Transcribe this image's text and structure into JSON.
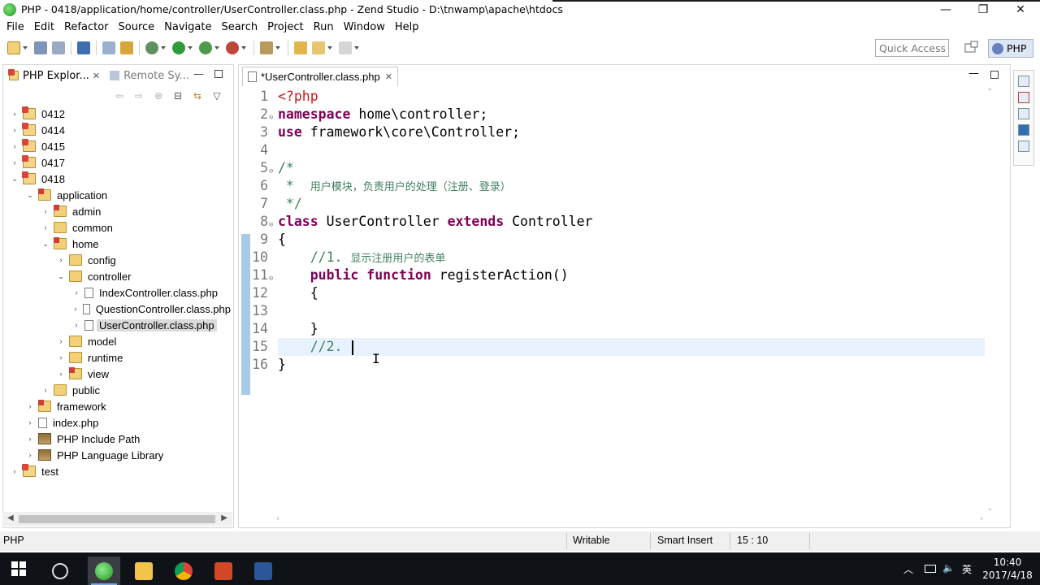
{
  "window": {
    "title": "PHP - 0418/application/home/controller/UserController.class.php - Zend Studio - D:\\tnwamp\\apache\\htdocs",
    "minimize_glyph": "—",
    "restore_glyph": "❐",
    "close_glyph": "✕"
  },
  "menu": [
    "File",
    "Edit",
    "Refactor",
    "Source",
    "Navigate",
    "Search",
    "Project",
    "Run",
    "Window",
    "Help"
  ],
  "toolbar": {
    "quick_access": "Quick Access",
    "perspective_label": "PHP"
  },
  "left_panel": {
    "tabs": [
      {
        "label": "PHP Explor...",
        "close": "✕"
      },
      {
        "label": "Remote Sy...",
        "close": ""
      }
    ],
    "min_glyph": "—",
    "toolbar_glyphs": [
      "⇦",
      "⇨",
      "⊛",
      "⊟",
      "⇆",
      "▽"
    ],
    "tree": [
      {
        "label": "0412",
        "depth": 0,
        "twisty": "›",
        "icon": "project"
      },
      {
        "label": "0414",
        "depth": 0,
        "twisty": "›",
        "icon": "project"
      },
      {
        "label": "0415",
        "depth": 0,
        "twisty": "›",
        "icon": "project"
      },
      {
        "label": "0417",
        "depth": 0,
        "twisty": "›",
        "icon": "project"
      },
      {
        "label": "0418",
        "depth": 0,
        "twisty": "⌄",
        "icon": "project"
      },
      {
        "label": "application",
        "depth": 1,
        "twisty": "⌄",
        "icon": "folder-lib"
      },
      {
        "label": "admin",
        "depth": 2,
        "twisty": "›",
        "icon": "folder-lib"
      },
      {
        "label": "common",
        "depth": 2,
        "twisty": "›",
        "icon": "folder"
      },
      {
        "label": "home",
        "depth": 2,
        "twisty": "⌄",
        "icon": "folder-lib"
      },
      {
        "label": "config",
        "depth": 3,
        "twisty": "›",
        "icon": "folder"
      },
      {
        "label": "controller",
        "depth": 3,
        "twisty": "⌄",
        "icon": "folder"
      },
      {
        "label": "IndexController.class.php",
        "depth": 4,
        "twisty": "›",
        "icon": "file"
      },
      {
        "label": "QuestionController.class.php",
        "depth": 4,
        "twisty": "›",
        "icon": "file"
      },
      {
        "label": "UserController.class.php",
        "depth": 4,
        "twisty": "›",
        "icon": "file",
        "selected": true
      },
      {
        "label": "model",
        "depth": 3,
        "twisty": "›",
        "icon": "folder"
      },
      {
        "label": "runtime",
        "depth": 3,
        "twisty": "›",
        "icon": "folder"
      },
      {
        "label": "view",
        "depth": 3,
        "twisty": "›",
        "icon": "folder-lib"
      },
      {
        "label": "public",
        "depth": 2,
        "twisty": "›",
        "icon": "folder"
      },
      {
        "label": "framework",
        "depth": 1,
        "twisty": "›",
        "icon": "folder-lib"
      },
      {
        "label": "index.php",
        "depth": 1,
        "twisty": "›",
        "icon": "file"
      },
      {
        "label": "PHP Include Path",
        "depth": 1,
        "twisty": "›",
        "icon": "lib"
      },
      {
        "label": "PHP Language Library",
        "depth": 1,
        "twisty": "›",
        "icon": "lib"
      },
      {
        "label": "test",
        "depth": 0,
        "twisty": "›",
        "icon": "project"
      }
    ]
  },
  "editor": {
    "tab_label": "*UserController.class.php",
    "tab_close": "✕",
    "min_glyph": "—",
    "current_line": 15,
    "lines": [
      {
        "n": "1",
        "fold": "",
        "tokens": [
          {
            "t": "<?php",
            "c": "tag"
          }
        ]
      },
      {
        "n": "2",
        "fold": "⊖",
        "tokens": [
          {
            "t": "namespace",
            "c": "kw"
          },
          {
            "t": " home\\controller;",
            "c": "plain"
          }
        ]
      },
      {
        "n": "3",
        "fold": "",
        "tokens": [
          {
            "t": "use",
            "c": "kw"
          },
          {
            "t": " framework\\core\\Controller;",
            "c": "plain"
          }
        ]
      },
      {
        "n": "4",
        "fold": "",
        "tokens": []
      },
      {
        "n": "5",
        "fold": "⊖",
        "tokens": [
          {
            "t": "/*",
            "c": "cm"
          }
        ]
      },
      {
        "n": "6",
        "fold": "",
        "tokens": [
          {
            "t": " *  ",
            "c": "cm"
          },
          {
            "t": "用户模块，负责用户的处理（注册、登录）",
            "c": "cm-cjk"
          }
        ]
      },
      {
        "n": "7",
        "fold": "",
        "tokens": [
          {
            "t": " */",
            "c": "cm"
          }
        ]
      },
      {
        "n": "8",
        "fold": "⊖",
        "tokens": [
          {
            "t": "class",
            "c": "kw"
          },
          {
            "t": " UserController ",
            "c": "plain"
          },
          {
            "t": "extends",
            "c": "kw"
          },
          {
            "t": " Controller",
            "c": "plain"
          }
        ]
      },
      {
        "n": "9",
        "fold": "",
        "tokens": [
          {
            "t": "{",
            "c": "plain"
          }
        ]
      },
      {
        "n": "10",
        "fold": "",
        "tokens": [
          {
            "t": "    //1. ",
            "c": "cm"
          },
          {
            "t": "显示注册用户的表单",
            "c": "cm-cjk"
          }
        ]
      },
      {
        "n": "11",
        "fold": "⊖",
        "tokens": [
          {
            "t": "    ",
            "c": "plain"
          },
          {
            "t": "public",
            "c": "kw"
          },
          {
            "t": " ",
            "c": "plain"
          },
          {
            "t": "function",
            "c": "kw"
          },
          {
            "t": " registerAction()",
            "c": "plain"
          }
        ]
      },
      {
        "n": "12",
        "fold": "",
        "tokens": [
          {
            "t": "    {",
            "c": "plain"
          }
        ]
      },
      {
        "n": "13",
        "fold": "",
        "tokens": []
      },
      {
        "n": "14",
        "fold": "",
        "tokens": [
          {
            "t": "    }",
            "c": "plain"
          }
        ]
      },
      {
        "n": "15",
        "fold": "",
        "tokens": [
          {
            "t": "    //2. ",
            "c": "cm"
          }
        ],
        "caret": true
      },
      {
        "n": "16",
        "fold": "",
        "tokens": [
          {
            "t": "}",
            "c": "plain"
          }
        ]
      }
    ]
  },
  "statusbar": {
    "left": "PHP",
    "writable": "Writable",
    "insert_mode": "Smart Insert",
    "position": "15 : 10"
  },
  "taskbar": {
    "tray_glyphs": [
      "︿",
      "🔈",
      "英"
    ],
    "time": "10:40",
    "date": "2017/4/18"
  },
  "colors": {
    "keyword": "#7f0055",
    "php_tag": "#c71a1a",
    "comment": "#3f7f5f",
    "current_line_bg": "#e8f2fe",
    "selection_bg": "#dadada"
  }
}
